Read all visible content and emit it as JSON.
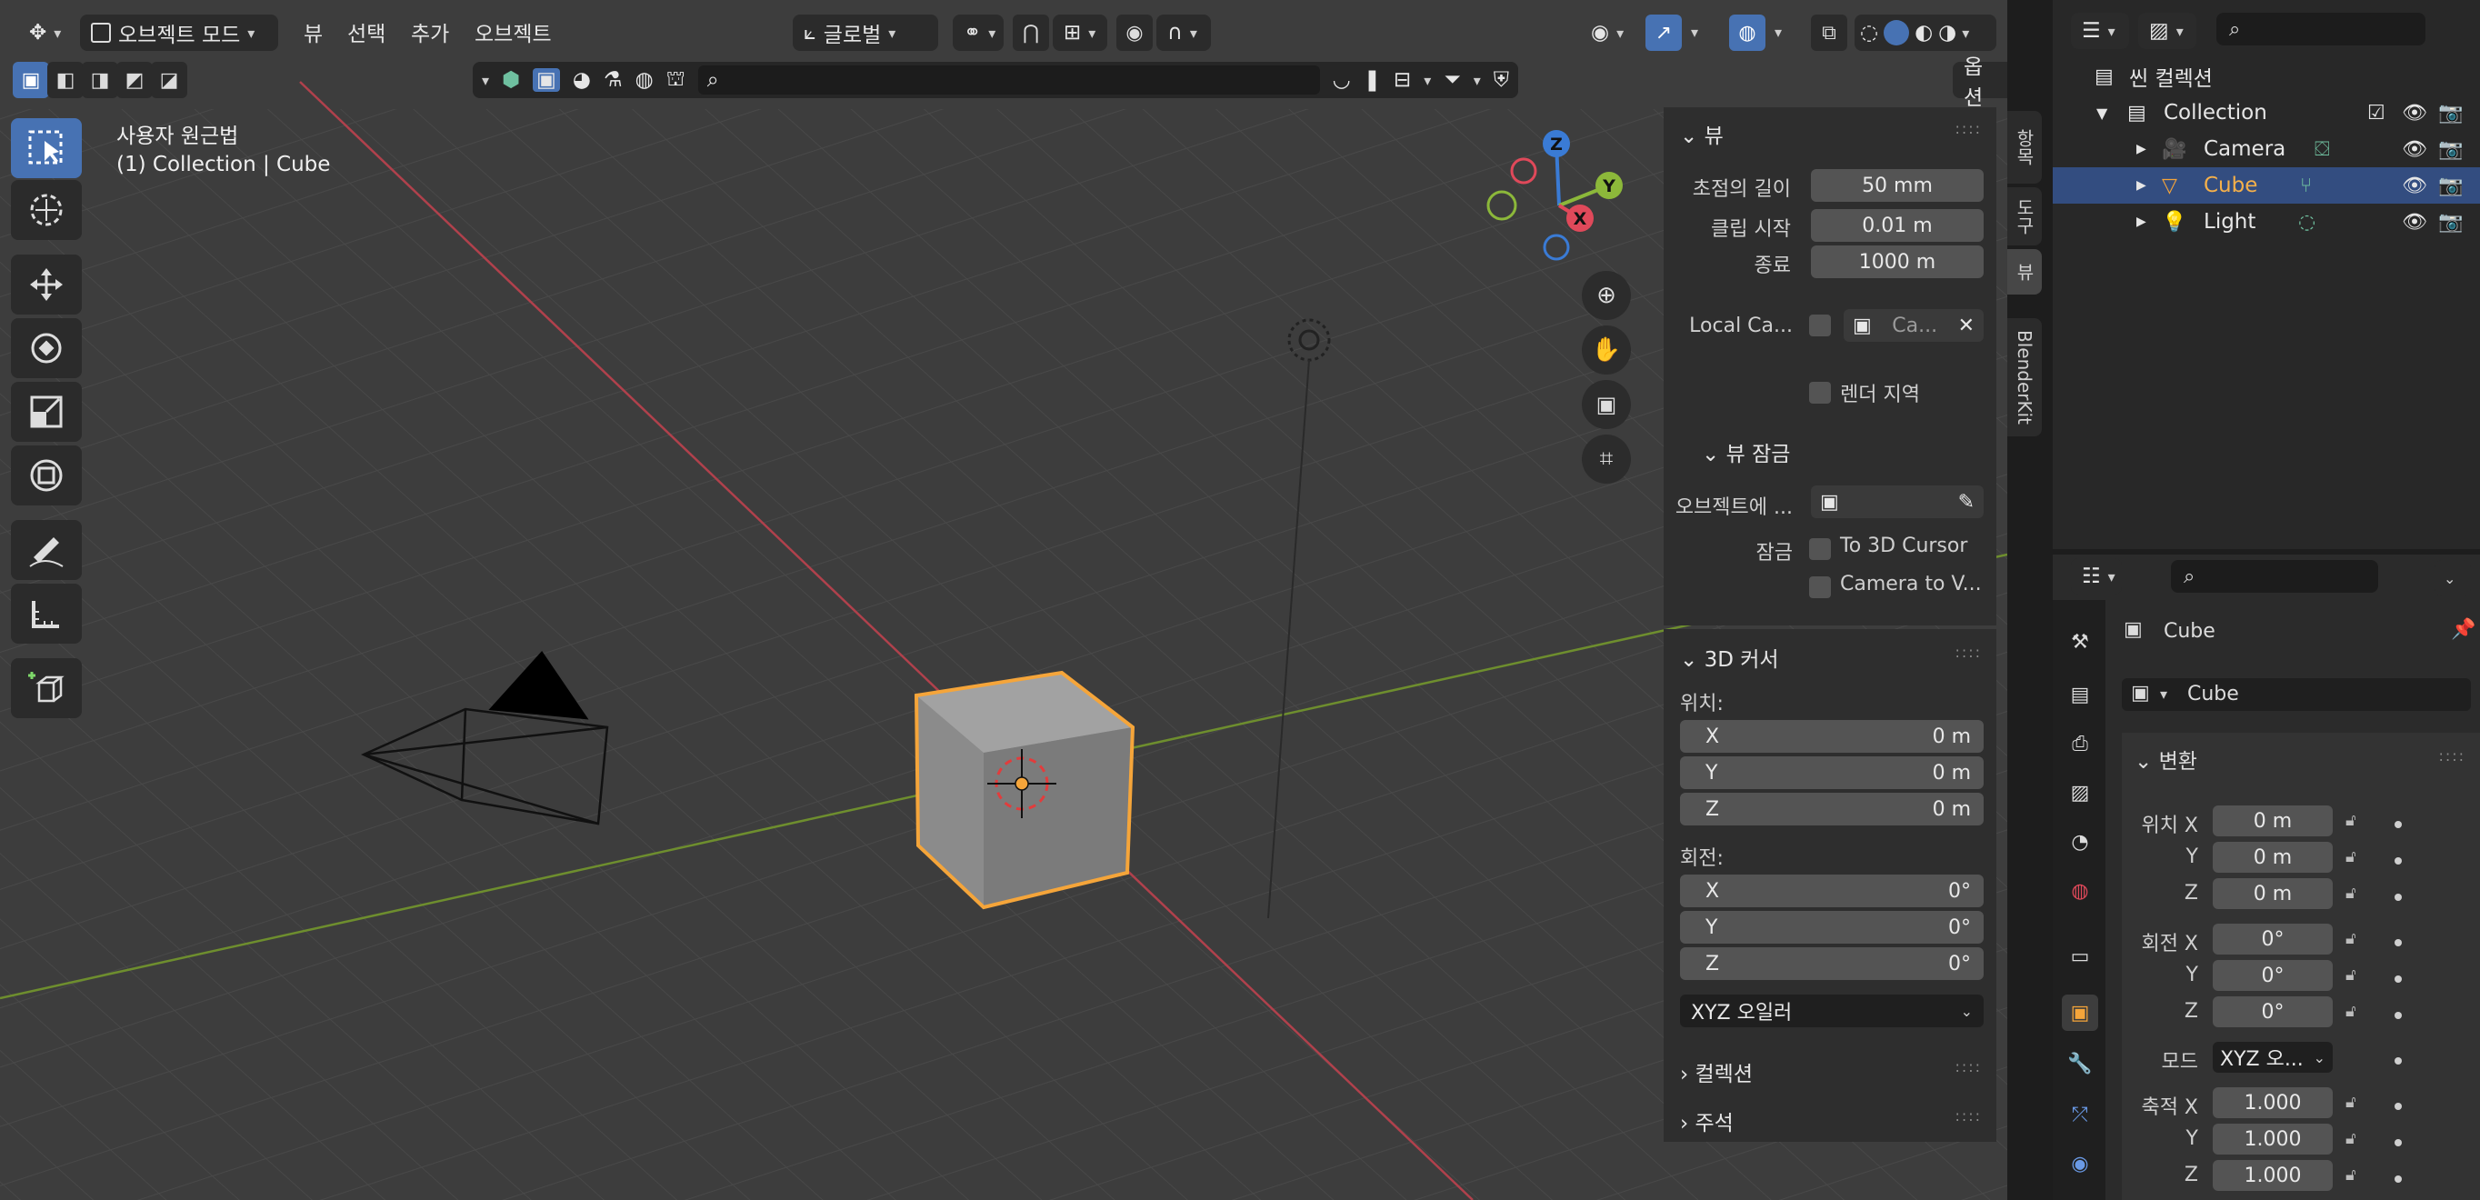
{
  "header": {
    "mode_label": "오브젝트 모드",
    "menus": [
      "뷰",
      "선택",
      "추가",
      "오브젝트"
    ],
    "transform_orientation": "글로벌",
    "options_label": "옵션"
  },
  "viewport": {
    "overlay_line1": "사용자 원근법",
    "overlay_line2": "(1) Collection | Cube",
    "gizmo_axes": {
      "x": "X",
      "y": "Y",
      "z": "Z"
    }
  },
  "npanel": {
    "view_title": "뷰",
    "focal_label": "초점의 길이",
    "focal_value": "50 mm",
    "clip_start_label": "클립 시작",
    "clip_start_value": "0.01 m",
    "clip_end_label": "종료",
    "clip_end_value": "1000 m",
    "local_camera_label": "Local Ca...",
    "local_camera_value": "Ca...",
    "render_region_label": "렌더 지역",
    "view_lock_title": "뷰 잠금",
    "lock_object_label": "오브젝트에 ...",
    "lock_label": "잠금",
    "to_3d_cursor": "To 3D Cursor",
    "camera_to_view": "Camera to V...",
    "cursor_title": "3D 커서",
    "location_label": "위치:",
    "loc_x": "0 m",
    "loc_y": "0 m",
    "loc_z": "0 m",
    "rotation_label": "회전:",
    "rot_x": "0°",
    "rot_y": "0°",
    "rot_z": "0°",
    "axis_x": "X",
    "axis_y": "Y",
    "axis_z": "Z",
    "rotation_mode": "XYZ 오일러",
    "collection_title": "컬렉션",
    "annotation_title": "주석"
  },
  "vtabs": [
    "항목",
    "도구",
    "뷰",
    "BlenderKit"
  ],
  "outliner": {
    "scene_collection": "씬 컬렉션",
    "collection": "Collection",
    "items": [
      {
        "name": "Camera"
      },
      {
        "name": "Cube"
      },
      {
        "name": "Light"
      }
    ]
  },
  "properties": {
    "object_name": "Cube",
    "data_name": "Cube",
    "transform_title": "변환",
    "loc_x_label": "위치 X",
    "loc_y_label": "Y",
    "loc_z_label": "Z",
    "loc_x": "0 m",
    "loc_y": "0 m",
    "loc_z": "0 m",
    "rot_x_label": "회전 X",
    "rot_y_label": "Y",
    "rot_z_label": "Z",
    "rot_x": "0°",
    "rot_y": "0°",
    "rot_z": "0°",
    "mode_label": "모드",
    "mode_value": "XYZ 오...",
    "scale_x_label": "축적 X",
    "scale_y_label": "Y",
    "scale_z_label": "Z",
    "scale_x": "1.000",
    "scale_y": "1.000",
    "scale_z": "1.000"
  },
  "colors": {
    "accent": "#4772b3",
    "selection_orange": "#f5a53a",
    "axis_x": "#e0495a",
    "axis_y": "#8cb83a",
    "axis_z": "#3a7bd5"
  }
}
